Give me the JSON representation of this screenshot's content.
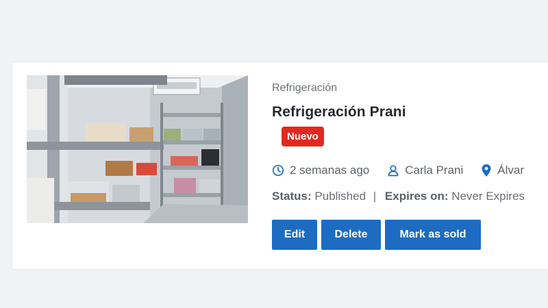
{
  "listing": {
    "category": "Refrigeración",
    "title": "Refrigeración Prani",
    "badge": "Nuevo",
    "posted": "2 semanas ago",
    "author": "Carla Prani",
    "location": "Álvar",
    "status_label": "Status:",
    "status_value": "Published",
    "separator": "|",
    "expires_label": "Expires on:",
    "expires_value": "Never Expires"
  },
  "actions": {
    "edit": "Edit",
    "delete": "Delete",
    "mark_sold": "Mark as sold"
  },
  "icons": {
    "time": "clock-icon",
    "author": "user-icon",
    "location": "map-pin-icon"
  },
  "colors": {
    "accent": "#1d6cc2",
    "badge": "#e12a1f",
    "background": "#f0f2f6"
  }
}
